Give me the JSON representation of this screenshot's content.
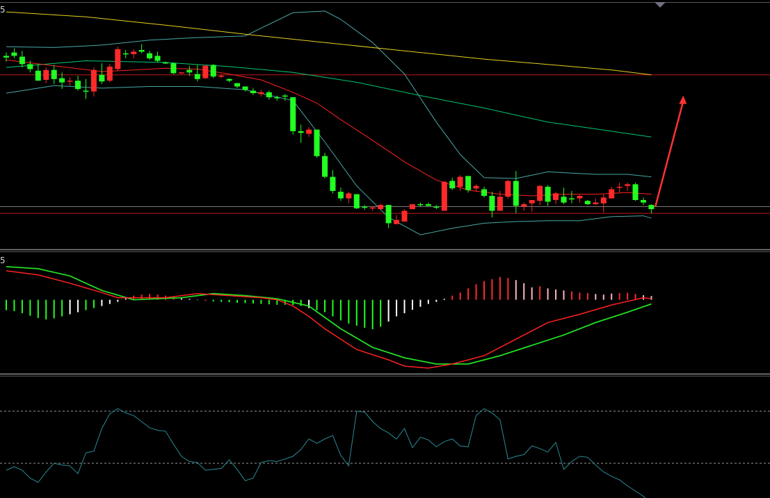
{
  "labels": {
    "price_panel": "5",
    "macd_panel": "5"
  },
  "colors": {
    "up": "#ff2a2a",
    "down": "#22ff22",
    "white_hist": "#ffffff",
    "pink_hist": "#ffb6c1",
    "ma_short": "#ff2222",
    "ma_mid": "#00c870",
    "ma_long": "#e8d020",
    "boll": "#4aa8a8",
    "level_line": "#c01818",
    "ref_line": "#7a7a7a",
    "macd_dif": "#ff2222",
    "macd_dea": "#22e022",
    "osc": "#2a8c96",
    "arrow": "#ff3333",
    "marker": "#707080"
  },
  "chart_data": [
    {
      "type": "candlestick",
      "title": "",
      "candles": [
        [
          52.6,
          53.0,
          51.9,
          52.4
        ],
        [
          53.0,
          53.5,
          52.3,
          52.6
        ],
        [
          52.5,
          53.2,
          51.2,
          51.6
        ],
        [
          51.6,
          52.0,
          50.6,
          51.0
        ],
        [
          50.8,
          51.6,
          49.6,
          49.6
        ],
        [
          49.7,
          51.2,
          49.3,
          50.9
        ],
        [
          50.9,
          51.5,
          49.2,
          49.8
        ],
        [
          49.9,
          50.6,
          48.6,
          49.4
        ],
        [
          49.5,
          50.0,
          49.0,
          49.6
        ],
        [
          49.6,
          50.2,
          48.4,
          48.6
        ],
        [
          48.4,
          49.8,
          47.4,
          48.3
        ],
        [
          48.3,
          51.2,
          47.7,
          50.9
        ],
        [
          50.3,
          51.7,
          49.2,
          49.5
        ],
        [
          49.6,
          51.6,
          49.4,
          51.3
        ],
        [
          51.0,
          53.7,
          50.8,
          53.4
        ],
        [
          52.9,
          53.3,
          52.3,
          52.8
        ],
        [
          52.8,
          53.4,
          52.3,
          53.1
        ],
        [
          53.3,
          54.0,
          52.9,
          53.1
        ],
        [
          52.9,
          53.2,
          52.1,
          52.3
        ],
        [
          52.6,
          53.1,
          51.8,
          52.0
        ],
        [
          51.8,
          51.9,
          51.6,
          51.7
        ],
        [
          51.7,
          51.8,
          50.4,
          50.5
        ],
        [
          50.6,
          50.6,
          50.4,
          50.6
        ],
        [
          50.9,
          51.4,
          50.2,
          50.6
        ],
        [
          50.4,
          51.5,
          49.5,
          49.8
        ],
        [
          49.9,
          51.5,
          49.8,
          51.4
        ],
        [
          51.5,
          51.6,
          49.9,
          50.1
        ],
        [
          50.1,
          50.4,
          49.9,
          50.2
        ],
        [
          49.8,
          49.9,
          49.4,
          49.6
        ],
        [
          49.3,
          49.3,
          48.7,
          48.9
        ],
        [
          48.9,
          48.9,
          48.3,
          48.5
        ],
        [
          48.4,
          48.7,
          47.9,
          48.1
        ],
        [
          48.0,
          48.5,
          47.7,
          48.2
        ],
        [
          48.2,
          48.4,
          47.3,
          47.6
        ],
        [
          47.6,
          47.8,
          47.2,
          47.5
        ],
        [
          47.8,
          48.0,
          47.2,
          47.7
        ],
        [
          47.6,
          47.6,
          43.1,
          43.5
        ],
        [
          43.5,
          44.3,
          42.1,
          43.3
        ],
        [
          43.2,
          44.0,
          42.8,
          43.7
        ],
        [
          43.7,
          43.7,
          40.3,
          40.5
        ],
        [
          40.5,
          40.9,
          37.8,
          38.0
        ],
        [
          38.0,
          38.8,
          36.0,
          36.3
        ],
        [
          36.2,
          36.7,
          35.1,
          35.4
        ],
        [
          35.4,
          36.2,
          34.8,
          36.0
        ],
        [
          35.9,
          35.9,
          34.1,
          34.2
        ],
        [
          34.4,
          34.6,
          34.0,
          34.3
        ],
        [
          34.2,
          34.4,
          33.9,
          34.3
        ],
        [
          34.1,
          34.8,
          34.1,
          34.6
        ],
        [
          34.6,
          34.6,
          31.8,
          32.4
        ],
        [
          32.3,
          33.4,
          32.3,
          32.8
        ],
        [
          32.6,
          34.1,
          32.6,
          33.9
        ],
        [
          34.1,
          34.7,
          34.1,
          34.7
        ],
        [
          34.7,
          34.9,
          34.4,
          34.6
        ],
        [
          34.7,
          34.9,
          34.5,
          34.5
        ],
        [
          34.4,
          34.6,
          34.1,
          34.3
        ],
        [
          33.9,
          37.5,
          33.9,
          37.4
        ],
        [
          37.5,
          37.9,
          36.4,
          36.6
        ],
        [
          36.8,
          38.2,
          36.3,
          38.0
        ],
        [
          38.1,
          38.1,
          36.1,
          36.4
        ],
        [
          36.6,
          37.1,
          36.2,
          36.9
        ],
        [
          36.5,
          36.8,
          35.5,
          35.7
        ],
        [
          35.7,
          36.2,
          33.1,
          33.9
        ],
        [
          33.9,
          36.3,
          33.9,
          35.6
        ],
        [
          35.6,
          37.6,
          35.4,
          37.5
        ],
        [
          37.5,
          38.7,
          33.6,
          34.5
        ],
        [
          34.4,
          34.9,
          33.9,
          34.7
        ],
        [
          34.8,
          35.2,
          33.8,
          35.2
        ],
        [
          35.1,
          37.0,
          34.6,
          36.9
        ],
        [
          36.8,
          37.0,
          34.5,
          35.0
        ],
        [
          35.2,
          36.2,
          34.7,
          36.0
        ],
        [
          35.6,
          36.7,
          34.7,
          34.9
        ],
        [
          35.4,
          36.3,
          34.8,
          35.3
        ],
        [
          35.4,
          35.8,
          34.9,
          35.7
        ],
        [
          35.1,
          35.2,
          34.6,
          34.7
        ],
        [
          34.7,
          35.4,
          34.6,
          34.9
        ],
        [
          34.8,
          35.9,
          33.7,
          35.5
        ],
        [
          35.4,
          36.8,
          35.4,
          36.5
        ],
        [
          36.7,
          37.3,
          36.1,
          36.8
        ],
        [
          36.9,
          37.3,
          36.3,
          37.1
        ],
        [
          37.1,
          37.3,
          35.1,
          35.2
        ],
        [
          35.2,
          35.5,
          34.6,
          34.9
        ],
        [
          34.6,
          34.7,
          33.6,
          34.1
        ]
      ],
      "ma_short": [
        [
          0,
          52.1
        ],
        [
          6,
          51.4
        ],
        [
          12,
          50.7
        ],
        [
          16,
          50.9
        ],
        [
          20,
          51.1
        ],
        [
          24,
          51.0
        ],
        [
          28,
          50.4
        ],
        [
          32,
          49.7
        ],
        [
          36,
          48.2
        ],
        [
          39,
          46.9
        ],
        [
          42,
          44.9
        ],
        [
          46,
          42.4
        ],
        [
          50,
          39.8
        ],
        [
          54,
          37.6
        ],
        [
          58,
          36.4
        ],
        [
          62,
          35.9
        ],
        [
          66,
          35.7
        ],
        [
          70,
          35.9
        ],
        [
          74,
          35.9
        ],
        [
          78,
          36.1
        ],
        [
          81,
          35.9
        ]
      ],
      "ma_mid": [
        [
          0,
          51.2
        ],
        [
          10,
          52.0
        ],
        [
          20,
          51.8
        ],
        [
          28,
          51.3
        ],
        [
          36,
          50.6
        ],
        [
          44,
          49.4
        ],
        [
          52,
          47.8
        ],
        [
          60,
          46.3
        ],
        [
          68,
          44.6
        ],
        [
          76,
          43.5
        ],
        [
          81,
          42.8
        ]
      ],
      "ma_long": [
        [
          0,
          57.9
        ],
        [
          10,
          57.3
        ],
        [
          20,
          56.3
        ],
        [
          30,
          55.2
        ],
        [
          40,
          54.2
        ],
        [
          50,
          53.2
        ],
        [
          60,
          52.2
        ],
        [
          70,
          51.4
        ],
        [
          76,
          50.9
        ],
        [
          81,
          50.3
        ]
      ],
      "boll_upper": [
        [
          0,
          53.7
        ],
        [
          6,
          53.6
        ],
        [
          12,
          53.9
        ],
        [
          18,
          54.5
        ],
        [
          24,
          54.8
        ],
        [
          30,
          55.0
        ],
        [
          36,
          57.8
        ],
        [
          40,
          58.0
        ],
        [
          42,
          57.0
        ],
        [
          46,
          54.2
        ],
        [
          50,
          50.4
        ],
        [
          54,
          44.6
        ],
        [
          57,
          40.7
        ],
        [
          60,
          37.9
        ],
        [
          64,
          37.8
        ],
        [
          68,
          38.6
        ],
        [
          74,
          38.3
        ],
        [
          78,
          38.3
        ],
        [
          81,
          38.0
        ]
      ],
      "boll_lower": [
        [
          0,
          48.1
        ],
        [
          6,
          49.0
        ],
        [
          12,
          48.7
        ],
        [
          18,
          48.9
        ],
        [
          24,
          48.9
        ],
        [
          30,
          48.5
        ],
        [
          36,
          47.2
        ],
        [
          40,
          42.2
        ],
        [
          44,
          36.9
        ],
        [
          48,
          33.1
        ],
        [
          52,
          31.0
        ],
        [
          56,
          31.8
        ],
        [
          60,
          32.4
        ],
        [
          64,
          32.6
        ],
        [
          68,
          32.7
        ],
        [
          72,
          32.7
        ],
        [
          76,
          33.2
        ],
        [
          80,
          33.3
        ],
        [
          81,
          33.0
        ]
      ],
      "levels": [
        50.3,
        33.6
      ],
      "ref_level": 34.4,
      "arrow": {
        "from": [
          81.5,
          34.4
        ],
        "to": [
          85,
          47.8
        ]
      }
    },
    {
      "type": "bar+line",
      "title": "",
      "hist_colors": [
        "green",
        "green",
        "green",
        "green",
        "green",
        "green",
        "green",
        "green",
        "white",
        "white",
        "green",
        "green",
        "white",
        "white",
        "white",
        "pink",
        "red",
        "red",
        "red",
        "red",
        "red",
        "red",
        "pink",
        "pink",
        "pink",
        "red",
        "green",
        "green",
        "green",
        "green",
        "green",
        "green",
        "green",
        "green",
        "green",
        "green",
        "green",
        "green",
        "white",
        "green",
        "green",
        "green",
        "green",
        "green",
        "green",
        "green",
        "green",
        "green",
        "white",
        "white",
        "white",
        "white",
        "white",
        "white",
        "white",
        "white",
        "red",
        "red",
        "red",
        "red",
        "red",
        "red",
        "red",
        "red",
        "pink",
        "pink",
        "pink",
        "red",
        "pink",
        "pink",
        "pink",
        "red",
        "red",
        "red",
        "pink",
        "pink",
        "pink",
        "red",
        "red",
        "red",
        "pink",
        "pink"
      ],
      "hist": [
        0.5,
        0.55,
        0.65,
        0.77,
        0.88,
        0.95,
        0.9,
        0.8,
        0.7,
        0.6,
        0.5,
        0.4,
        0.3,
        0.2,
        0.1,
        -0.1,
        -0.2,
        -0.25,
        -0.28,
        -0.25,
        -0.2,
        -0.15,
        -0.1,
        -0.05,
        0.02,
        0.05,
        0.08,
        0.1,
        0.12,
        0.15,
        0.16,
        0.18,
        0.2,
        0.22,
        0.24,
        0.24,
        0.25,
        0.3,
        0.4,
        0.5,
        0.6,
        0.8,
        1.0,
        1.15,
        1.25,
        1.35,
        1.42,
        1.3,
        1.05,
        0.8,
        0.65,
        0.48,
        0.34,
        0.2,
        0.1,
        -0.05,
        -0.2,
        -0.35,
        -0.55,
        -0.75,
        -0.9,
        -1.0,
        -1.1,
        -1.05,
        -0.95,
        -0.8,
        -0.6,
        -0.65,
        -0.55,
        -0.5,
        -0.45,
        -0.4,
        -0.35,
        -0.32,
        -0.28,
        -0.25,
        -0.3,
        -0.32,
        -0.34,
        -0.28,
        -0.22,
        -0.18
      ],
      "dif": [
        [
          0,
          1.4
        ],
        [
          4,
          1.2
        ],
        [
          8,
          0.8
        ],
        [
          12,
          0.35
        ],
        [
          14,
          0.1
        ],
        [
          17,
          0.1
        ],
        [
          20,
          0.1
        ],
        [
          24,
          0.3
        ],
        [
          28,
          0.2
        ],
        [
          32,
          0.1
        ],
        [
          34,
          0.0
        ],
        [
          36,
          -0.3
        ],
        [
          38,
          -0.8
        ],
        [
          40,
          -1.4
        ],
        [
          44,
          -2.4
        ],
        [
          48,
          -2.9
        ],
        [
          50,
          -3.2
        ],
        [
          53,
          -3.3
        ],
        [
          56,
          -3.1
        ],
        [
          60,
          -2.7
        ],
        [
          64,
          -1.9
        ],
        [
          68,
          -1.1
        ],
        [
          72,
          -0.7
        ],
        [
          76,
          -0.25
        ],
        [
          80,
          0.1
        ],
        [
          81,
          0.05
        ]
      ],
      "dea": [
        [
          0,
          1.6
        ],
        [
          4,
          1.5
        ],
        [
          8,
          1.15
        ],
        [
          12,
          0.45
        ],
        [
          16,
          0.0
        ],
        [
          22,
          0.1
        ],
        [
          26,
          0.3
        ],
        [
          30,
          0.2
        ],
        [
          34,
          0.05
        ],
        [
          38,
          -0.3
        ],
        [
          42,
          -1.4
        ],
        [
          46,
          -2.3
        ],
        [
          50,
          -2.8
        ],
        [
          54,
          -3.1
        ],
        [
          58,
          -3.1
        ],
        [
          62,
          -2.7
        ],
        [
          66,
          -2.2
        ],
        [
          70,
          -1.7
        ],
        [
          74,
          -1.1
        ],
        [
          78,
          -0.6
        ],
        [
          81,
          -0.2
        ]
      ],
      "ylim": [
        -3.5,
        2.2
      ]
    },
    {
      "type": "line",
      "title": "",
      "reference_lines": [
        80,
        20
      ],
      "values": [
        12,
        16,
        12,
        3,
        -2,
        10,
        20,
        18,
        17,
        8,
        32,
        34,
        60,
        77,
        83,
        78,
        75,
        68,
        61,
        58,
        57,
        42,
        28,
        22,
        21,
        12,
        13,
        14,
        24,
        13,
        0,
        3,
        21,
        23,
        22,
        25,
        28,
        36,
        48,
        43,
        48,
        52,
        29,
        17,
        80,
        79,
        68,
        60,
        55,
        48,
        60,
        38,
        50,
        47,
        39,
        45,
        48,
        40,
        39,
        75,
        83,
        78,
        70,
        25,
        28,
        30,
        40,
        37,
        33,
        44,
        13,
        22,
        28,
        27,
        18,
        10,
        5,
        1,
        -6,
        -12,
        -18,
        -27
      ]
    }
  ]
}
